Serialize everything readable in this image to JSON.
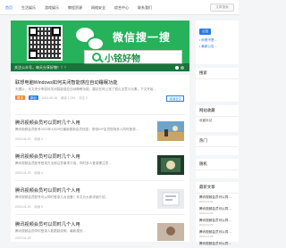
{
  "nav": {
    "items": [
      "首页",
      "生活娱乐",
      "游戏娱乐",
      "教程资源",
      "网络安全",
      "综合中心",
      "联系我们"
    ],
    "active_index": 0,
    "search_placeholder": "文章搜索"
  },
  "banner": {
    "wx_title": "微信搜一搜",
    "wx_box_text": "小铭好物",
    "caption": "关注公众号，每天分享好物！！！"
  },
  "posts": [
    {
      "title": "联想电脑Windows如何关闭智能感应自动睡眠功能",
      "excerpt": "无图片，本文来分享如何关闭智能感应自动睡眠功能，建议在网上找了很久无意义元素，下文开始…",
      "meta": [
        "置顶",
        "原创",
        "2023-05-18",
        "阅读 1,234",
        "评论 0"
      ],
      "more": "阅读全文"
    },
    {
      "title": "腾讯视频会员可以同时几个人用",
      "excerpt": "腾讯视频会员账号2023年4月29日最新更新会员信息，带领VIP会员现场多人同时登录…",
      "meta": [
        "2023-04-29",
        "阅读 0"
      ]
    },
    {
      "title": "腾讯视频会员可以同时几个人用",
      "excerpt": "腾讯视频会员账号登录方法和注意事项介绍，同时多人登录需注意…",
      "meta": [
        "2023-04-29",
        "阅读 0"
      ]
    },
    {
      "title": "腾讯视频会员可以同时几个人用",
      "excerpt": "腾讯视频会员账号可以同时登录几台设备？本文为大家详细介绍…",
      "meta": [
        "2023-04-29",
        "阅读 0"
      ]
    },
    {
      "title": "腾讯视频会员可以同时几个人用",
      "excerpt": "腾讯视频会员同时登录人数限制说明，最新规则…",
      "meta": [
        "2023-04-29"
      ]
    }
  ],
  "sidebar": {
    "notice_btn": "公告",
    "notice_items": [
      "• 你是不是…",
      "• 最新公告…"
    ],
    "search_head": "搜索",
    "visitors_head": "网站收藏",
    "visitors_text": "收藏本站",
    "hot_head": "热门",
    "random_head": "随机",
    "latest_head": "最新文章",
    "latest": [
      {
        "title": "腾讯视频会员可以同…",
        "time": "2023-04-29"
      },
      {
        "title": "腾讯视频会员可以同…",
        "time": "2023-04-29"
      },
      {
        "title": "腾讯视频会员可以同…",
        "time": "2023-04-29"
      },
      {
        "title": "腾讯视频会员可以同…",
        "time": "2023-04-29"
      },
      {
        "title": "腾讯视频会员可以同…",
        "time": "2023-04-29"
      }
    ]
  },
  "colors": {
    "accent": "#2a7ae2",
    "wechat_green": "#25b25a"
  }
}
